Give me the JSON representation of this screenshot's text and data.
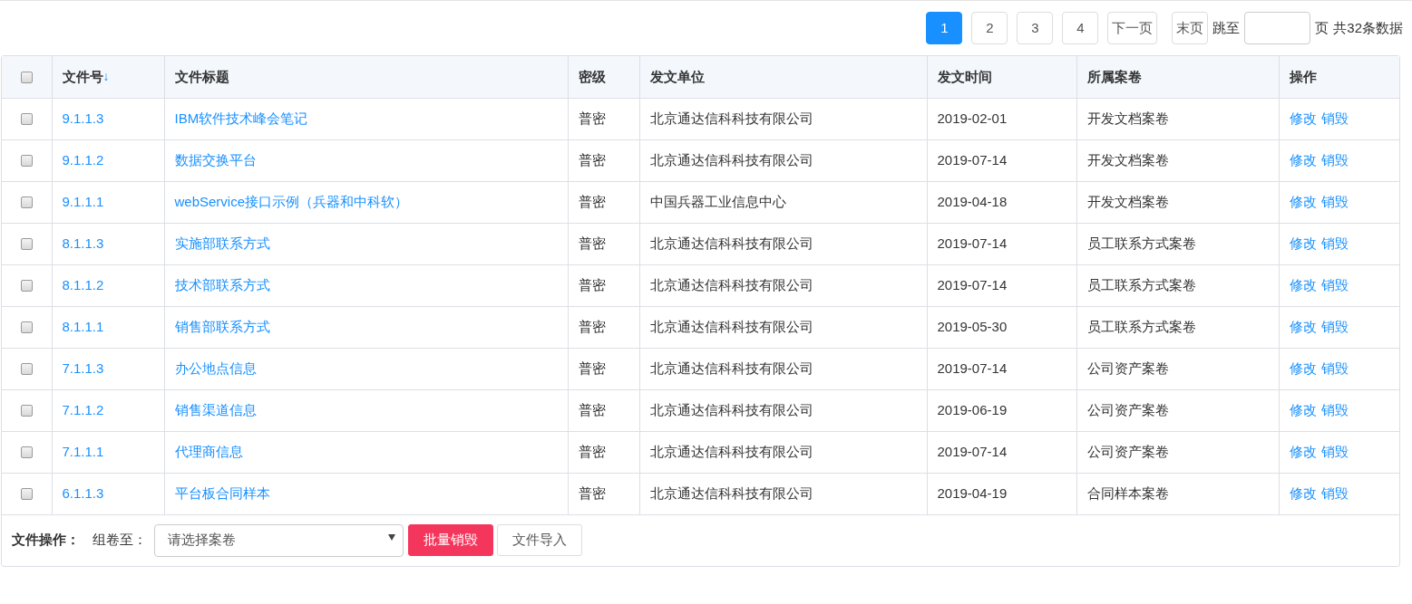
{
  "pagination": {
    "pages": [
      {
        "label": "1",
        "selected": true
      },
      {
        "label": "2",
        "selected": false
      },
      {
        "label": "3",
        "selected": false
      },
      {
        "label": "4",
        "selected": false
      }
    ],
    "next": "下一页",
    "last": "末页",
    "jump_label": "跳至",
    "page_suffix": "页",
    "total": "共32条数据"
  },
  "table": {
    "select_all": {
      "checked": false
    },
    "columns": [
      {
        "label": "文件号",
        "sort": "↓"
      },
      {
        "label": "文件标题"
      },
      {
        "label": "密级"
      },
      {
        "label": "发文单位"
      },
      {
        "label": "发文时间"
      },
      {
        "label": "所属案卷"
      },
      {
        "label": "操作"
      }
    ],
    "rows": [
      {
        "checked": false,
        "number": "9.1.1.3",
        "title": "IBM软件技术峰会笔记",
        "level": "普密",
        "unit": "北京通达信科科技有限公司",
        "date": "2019-02-01",
        "volume": "开发文档案卷",
        "actions": [
          "修改",
          "销毁"
        ]
      },
      {
        "checked": false,
        "number": "9.1.1.2",
        "title": "数据交换平台",
        "level": "普密",
        "unit": "北京通达信科科技有限公司",
        "date": "2019-07-14",
        "volume": "开发文档案卷",
        "actions": [
          "修改",
          "销毁"
        ]
      },
      {
        "checked": false,
        "number": "9.1.1.1",
        "title": "webService接口示例（兵器和中科软）",
        "level": "普密",
        "unit": "中国兵器工业信息中心",
        "date": "2019-04-18",
        "volume": "开发文档案卷",
        "actions": [
          "修改",
          "销毁"
        ]
      },
      {
        "checked": false,
        "number": "8.1.1.3",
        "title": "实施部联系方式",
        "level": "普密",
        "unit": "北京通达信科科技有限公司",
        "date": "2019-07-14",
        "volume": "员工联系方式案卷",
        "actions": [
          "修改",
          "销毁"
        ]
      },
      {
        "checked": false,
        "number": "8.1.1.2",
        "title": "技术部联系方式",
        "level": "普密",
        "unit": "北京通达信科科技有限公司",
        "date": "2019-07-14",
        "volume": "员工联系方式案卷",
        "actions": [
          "修改",
          "销毁"
        ]
      },
      {
        "checked": false,
        "number": "8.1.1.1",
        "title": "销售部联系方式",
        "level": "普密",
        "unit": "北京通达信科科技有限公司",
        "date": "2019-05-30",
        "volume": "员工联系方式案卷",
        "actions": [
          "修改",
          "销毁"
        ]
      },
      {
        "checked": false,
        "number": "7.1.1.3",
        "title": "办公地点信息",
        "level": "普密",
        "unit": "北京通达信科科技有限公司",
        "date": "2019-07-14",
        "volume": "公司资产案卷",
        "actions": [
          "修改",
          "销毁"
        ]
      },
      {
        "checked": false,
        "number": "7.1.1.2",
        "title": "销售渠道信息",
        "level": "普密",
        "unit": "北京通达信科科技有限公司",
        "date": "2019-06-19",
        "volume": "公司资产案卷",
        "actions": [
          "修改",
          "销毁"
        ]
      },
      {
        "checked": false,
        "number": "7.1.1.1",
        "title": "代理商信息",
        "level": "普密",
        "unit": "北京通达信科科技有限公司",
        "date": "2019-07-14",
        "volume": "公司资产案卷",
        "actions": [
          "修改",
          "销毁"
        ]
      },
      {
        "checked": false,
        "number": "6.1.1.3",
        "title": "平台板合同样本",
        "level": "普密",
        "unit": "北京通达信科科技有限公司",
        "date": "2019-04-19",
        "volume": "合同样本案卷",
        "actions": [
          "修改",
          "销毁"
        ]
      }
    ]
  },
  "footer": {
    "label": "文件操作：",
    "group_label": "组卷至：",
    "select_placeholder": "请选择案卷",
    "buttons": [
      {
        "label": "批量销毁",
        "kind": "danger"
      },
      {
        "label": "文件导入",
        "kind": "default"
      }
    ]
  }
}
